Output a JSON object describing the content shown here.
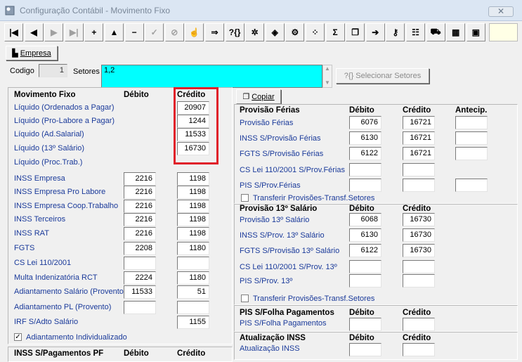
{
  "window": {
    "title": "Configuração Contábil - Movimento Fixo",
    "close": "✕"
  },
  "toolbar": [
    {
      "name": "first-record-button",
      "glyph": "|◀",
      "dim": false
    },
    {
      "name": "prev-record-button",
      "glyph": "◀",
      "dim": false
    },
    {
      "name": "next-record-button",
      "glyph": "▶",
      "dim": true
    },
    {
      "name": "last-record-button",
      "glyph": "▶|",
      "dim": true
    },
    {
      "name": "insert-button",
      "glyph": "+",
      "dim": false
    },
    {
      "name": "edit-button",
      "glyph": "▲",
      "dim": false
    },
    {
      "name": "delete-button",
      "glyph": "−",
      "dim": false
    },
    {
      "name": "confirm-button",
      "glyph": "✓",
      "dim": true
    },
    {
      "name": "cancel-button",
      "glyph": "⊘",
      "dim": true
    },
    {
      "name": "hand-icon",
      "glyph": "☝",
      "dim": false
    },
    {
      "name": "export-icon",
      "glyph": "⇒",
      "dim": false
    },
    {
      "name": "query-icon",
      "glyph": "?{}",
      "dim": false
    },
    {
      "name": "config-icon",
      "glyph": "✲",
      "dim": false
    },
    {
      "name": "report-icon",
      "glyph": "◈",
      "dim": false
    },
    {
      "name": "network-icon",
      "glyph": "⚙",
      "dim": false
    },
    {
      "name": "dots-icon",
      "glyph": "⁘",
      "dim": false
    },
    {
      "name": "sum-icon",
      "glyph": "Σ",
      "dim": false
    },
    {
      "name": "copy-icon",
      "glyph": "❐",
      "dim": false
    },
    {
      "name": "exit-icon",
      "glyph": "➔",
      "dim": false
    },
    {
      "name": "key-icon",
      "glyph": "⚷",
      "dim": false
    },
    {
      "name": "tools-icon",
      "glyph": "☷",
      "dim": false
    },
    {
      "name": "truck-icon",
      "glyph": "⛟",
      "dim": false
    },
    {
      "name": "calendar-icon",
      "glyph": "▦",
      "dim": false
    },
    {
      "name": "stop-icon",
      "glyph": "▣",
      "dim": false
    }
  ],
  "top": {
    "empresa_label": "Empresa",
    "codigo_label": "Codigo",
    "codigo_value": "1",
    "setores_label": "Setores",
    "setores_value": "1,2",
    "select_setores_label": "Selecionar Setores",
    "copiar_label": "Copiar"
  },
  "left": {
    "header": {
      "title": "Movimento Fixo",
      "debito": "Débito",
      "credito": "Crédito"
    },
    "rows": [
      {
        "label": "Líquido (Ordenados a Pagar)",
        "debito": null,
        "credito": "20907"
      },
      {
        "label": "Líquido (Pro-Labore a Pagar)",
        "debito": null,
        "credito": "1244"
      },
      {
        "label": "Líquido (Ad.Salarial)",
        "debito": null,
        "credito": "11533"
      },
      {
        "label": "Líquido (13º Salário)",
        "debito": null,
        "credito": "16730"
      },
      {
        "label": "Líquido (Proc.Trab.)",
        "debito": null,
        "credito": null
      },
      {
        "label": "INSS Empresa",
        "debito": "2216",
        "credito": "1198"
      },
      {
        "label": "INSS Empresa Pro Labore",
        "debito": "2216",
        "credito": "1198"
      },
      {
        "label": "INSS Empresa Coop.Trabalho",
        "debito": "2216",
        "credito": "1198"
      },
      {
        "label": "INSS Terceiros",
        "debito": "2216",
        "credito": "1198"
      },
      {
        "label": "INSS RAT",
        "debito": "2216",
        "credito": "1198"
      },
      {
        "label": "FGTS",
        "debito": "2208",
        "credito": "1180"
      },
      {
        "label": "CS Lei 110/2001",
        "debito": "",
        "credito": ""
      },
      {
        "label": "Multa Indenizatória RCT",
        "debito": "2224",
        "credito": "1180"
      },
      {
        "label": "Adiantamento Salário (Provento)",
        "debito": "11533",
        "credito": "51"
      },
      {
        "label": "Adiantamento PL (Provento)",
        "debito": "",
        "credito": ""
      },
      {
        "label": "IRF S/Adto Salário",
        "debito": null,
        "credito": "1155"
      }
    ],
    "adiantamento_checkbox": "Adiantamento Individualizado",
    "inss_header": {
      "title": "INSS S/Pagamentos PF",
      "debito": "Débito",
      "credito": "Crédito"
    }
  },
  "ferias": {
    "header": {
      "title": "Provisão Férias",
      "debito": "Débito",
      "credito": "Crédito",
      "antecip": "Antecip."
    },
    "rows": [
      {
        "label": "Provisão Férias",
        "debito": "6076",
        "credito": "16721",
        "antecip": ""
      },
      {
        "label": "INSS S/Provisão Férias",
        "debito": "6130",
        "credito": "16721",
        "antecip": ""
      },
      {
        "label": "FGTS S/Provisão Férias",
        "debito": "6122",
        "credito": "16721",
        "antecip": ""
      },
      {
        "label": "CS Lei 110/2001 S/Prov.Férias",
        "debito": "",
        "credito": "",
        "antecip": null
      },
      {
        "label": "PIS S/Prov.Férias",
        "debito": "",
        "credito": "",
        "antecip": ""
      }
    ],
    "transfer_checkbox": "Transferir Provisões-Transf.Setores"
  },
  "decimo": {
    "header": {
      "title": "Provisão 13º Salário",
      "debito": "Débito",
      "credito": "Crédito"
    },
    "rows": [
      {
        "label": "Provisão 13º Salário",
        "debito": "6068",
        "credito": "16730"
      },
      {
        "label": "INSS S/Prov. 13º Salário",
        "debito": "6130",
        "credito": "16730"
      },
      {
        "label": "FGTS S/Provisão 13º Salário",
        "debito": "6122",
        "credito": "16730"
      },
      {
        "label": "CS Lei 110/2001 S/Prov. 13º",
        "debito": "",
        "credito": ""
      },
      {
        "label": "PIS S/Prov. 13º",
        "debito": "",
        "credito": ""
      }
    ],
    "transfer_checkbox": "Transferir Provisões-Transf.Setores"
  },
  "pis": {
    "header": {
      "title": "PIS S/Folha Pagamentos",
      "debito": "Débito",
      "credito": "Crédito"
    },
    "row": "PIS S/Folha Pagamentos"
  },
  "inss_upd": {
    "header": {
      "title": "Atualização INSS",
      "debito": "Débito",
      "credito": "Crédito"
    },
    "row": "Atualização INSS"
  },
  "colors": {
    "accent_field": "#00ffff",
    "highlight": "#e0202a",
    "label_blue": "#1a3a9a"
  }
}
